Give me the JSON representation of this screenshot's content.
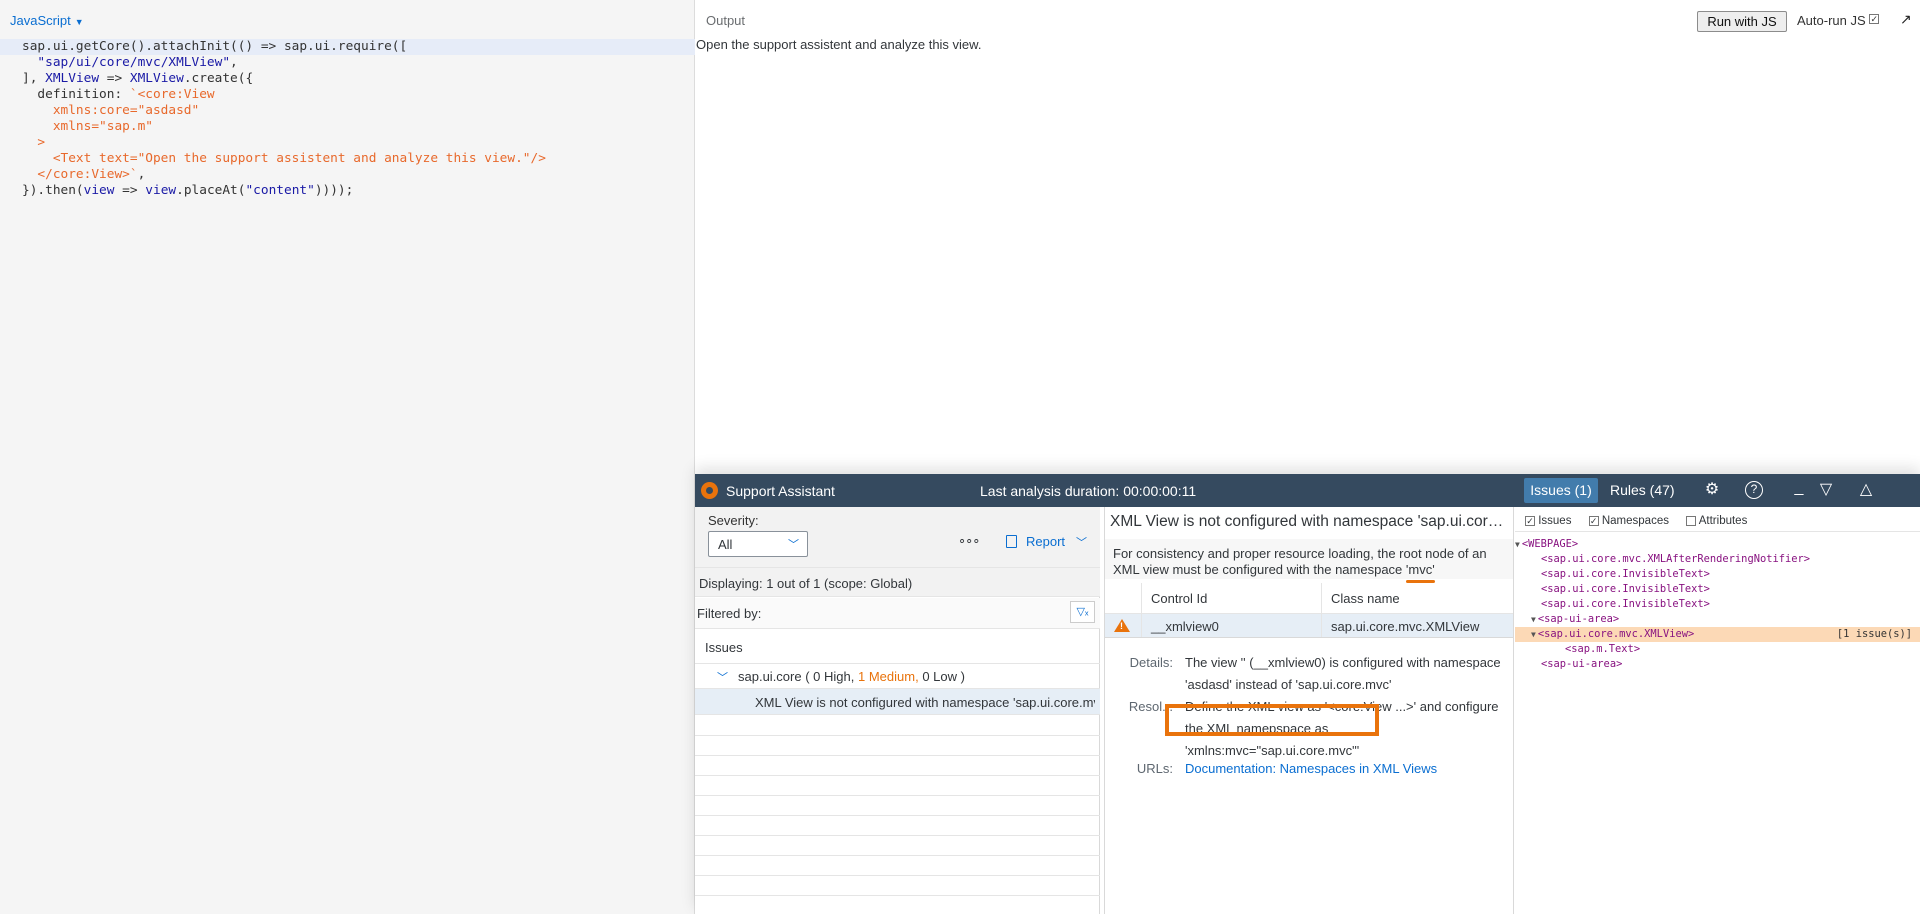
{
  "editor": {
    "language": "JavaScript",
    "lines": [
      {
        "parts": [
          {
            "t": "sap.ui.getCore().attachInit(() => sap.ui.require(["
          }
        ]
      },
      {
        "parts": [
          {
            "t": "  "
          },
          {
            "t": "\"sap/ui/core/mvc/XMLView\"",
            "c": "t-str"
          },
          {
            "t": ","
          }
        ]
      },
      {
        "parts": [
          {
            "t": "], "
          },
          {
            "t": "XMLView",
            "c": "t-var"
          },
          {
            "t": " => "
          },
          {
            "t": "XMLView",
            "c": "t-var"
          },
          {
            "t": ".create({"
          }
        ]
      },
      {
        "parts": [
          {
            "t": "  definition: "
          },
          {
            "t": "`<core:View",
            "c": "t-tpl"
          }
        ]
      },
      {
        "parts": [
          {
            "t": "    xmlns:core=\"asdasd\"",
            "c": "t-tpl"
          }
        ]
      },
      {
        "parts": [
          {
            "t": "    xmlns=\"sap.m\"",
            "c": "t-tpl"
          }
        ]
      },
      {
        "parts": [
          {
            "t": "  >",
            "c": "t-tpl"
          }
        ]
      },
      {
        "parts": [
          {
            "t": "    <Text text=\"Open the support assistent and analyze this view.\"/>",
            "c": "t-tpl"
          }
        ]
      },
      {
        "parts": [
          {
            "t": "  </core:View>`",
            "c": "t-tpl"
          },
          {
            "t": ","
          }
        ]
      },
      {
        "parts": [
          {
            "t": "}).then("
          },
          {
            "t": "view",
            "c": "t-var"
          },
          {
            "t": " => "
          },
          {
            "t": "view",
            "c": "t-var"
          },
          {
            "t": ".placeAt("
          },
          {
            "t": "\"content\"",
            "c": "t-str"
          },
          {
            "t": "))));"
          }
        ]
      }
    ]
  },
  "output": {
    "label": "Output",
    "run_button": "Run with JS",
    "autorun_label": "Auto-run JS",
    "autorun_checked": true,
    "text": "Open the support assistent and analyze this view."
  },
  "support_assistant": {
    "title": "Support Assistant",
    "duration": "Last analysis duration: 00:00:00:11",
    "tab_issues": "Issues (1)",
    "tab_rules": "Rules (47)",
    "icons": [
      "settings-icon",
      "help-icon",
      "minimize-icon",
      "filter-icon",
      "collapse-icon"
    ],
    "issues_panel": {
      "severity_label": "Severity:",
      "severity_value": "All",
      "more": "∘∘∘",
      "report": "Report",
      "displaying": "Displaying: 1 out of 1 (scope: Global)",
      "filtered_by": "Filtered by:",
      "issues_heading": "Issues",
      "group": {
        "name": "sap.ui.core (",
        "high": "0 High,",
        "medium": "1 Medium,",
        "low": "0 Low )"
      },
      "issue": "XML View is not configured with namespace 'sap.ui.core.mvc'"
    },
    "detail_panel": {
      "title": "XML View is not configured with namespace 'sap.ui.core.mvc'",
      "desc_before": "For consistency and proper resource loading, the root node of an XML view must be configured with the namespace '",
      "desc_mark": "mvc",
      "desc_after": "'",
      "col_control": "Control Id",
      "col_class": "Class name",
      "row_control": "__xmlview0",
      "row_class": "sap.ui.core.mvc.XMLView",
      "details_label": "Details:",
      "details_text": "The view '' (__xmlview0) is configured with namespace 'asdasd' instead of 'sap.ui.core.mvc'",
      "resolution_label": "Resol...",
      "resolution_text": "Define the XML view as '<core:View ...>' and configure the XML namepspace as 'xmlns:mvc=\"sap.ui.core.mvc\"'",
      "urls_label": "URLs:",
      "url_text": "Documentation: Namespaces in XML Views"
    },
    "tree_panel": {
      "check_issues": "Issues",
      "check_namespaces": "Namespaces",
      "check_attributes": "Attributes",
      "nodes": [
        {
          "tog": "▼",
          "label": "<WEBPAGE>",
          "lvl": 0
        },
        {
          "tog": "",
          "label": "<sap.ui.core.mvc.XMLAfterRenderingNotifier>",
          "lvl": 1
        },
        {
          "tog": "",
          "label": "<sap.ui.core.InvisibleText>",
          "lvl": 1
        },
        {
          "tog": "",
          "label": "<sap.ui.core.InvisibleText>",
          "lvl": 1
        },
        {
          "tog": "",
          "label": "<sap.ui.core.InvisibleText>",
          "lvl": 1
        },
        {
          "tog": "▼",
          "label": "<sap-ui-area>",
          "lvl": 1
        },
        {
          "tog": "▼",
          "label": "<sap.ui.core.mvc.XMLView>",
          "lvl": 2,
          "sel": true,
          "count": "[1 issue(s)]"
        },
        {
          "tog": "",
          "label": "<sap.m.Text>",
          "lvl": 3
        },
        {
          "tog": "",
          "label": "<sap-ui-area>",
          "lvl": 1
        }
      ]
    }
  }
}
